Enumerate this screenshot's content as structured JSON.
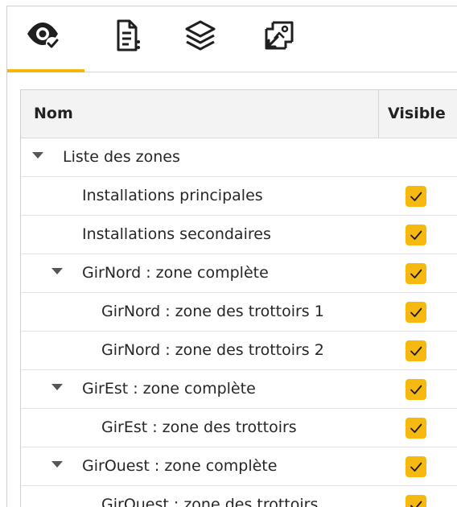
{
  "tabs": [
    {
      "id": "visibility",
      "icon": "eye-check-icon",
      "active": true
    },
    {
      "id": "document",
      "icon": "document-settings-icon",
      "active": false
    },
    {
      "id": "layers",
      "icon": "layers-icon",
      "active": false
    },
    {
      "id": "image-export",
      "icon": "image-export-icon",
      "active": false
    }
  ],
  "colors": {
    "accent": "#f5b50a",
    "checkbox": "#f7b90f",
    "header_bg": "#f3f3f3"
  },
  "table": {
    "columns": {
      "name": "Nom",
      "visible": "Visible"
    },
    "rows": [
      {
        "label": "Liste des zones",
        "level": 0,
        "expandable": true,
        "visible": null
      },
      {
        "label": "Installations principales",
        "level": 1,
        "expandable": false,
        "visible": true
      },
      {
        "label": "Installations secondaires",
        "level": 1,
        "expandable": false,
        "visible": true
      },
      {
        "label": "GirNord : zone complète",
        "level": 1,
        "expandable": true,
        "visible": true
      },
      {
        "label": "GirNord : zone des trottoirs 1",
        "level": 2,
        "expandable": false,
        "visible": true
      },
      {
        "label": "GirNord : zone des trottoirs 2",
        "level": 2,
        "expandable": false,
        "visible": true
      },
      {
        "label": "GirEst : zone complète",
        "level": 1,
        "expandable": true,
        "visible": true
      },
      {
        "label": "GirEst : zone des trottoirs",
        "level": 2,
        "expandable": false,
        "visible": true
      },
      {
        "label": "GirOuest : zone complète",
        "level": 1,
        "expandable": true,
        "visible": true
      },
      {
        "label": "GirOuest : zone des trottoirs",
        "level": 2,
        "expandable": false,
        "visible": true
      }
    ]
  }
}
